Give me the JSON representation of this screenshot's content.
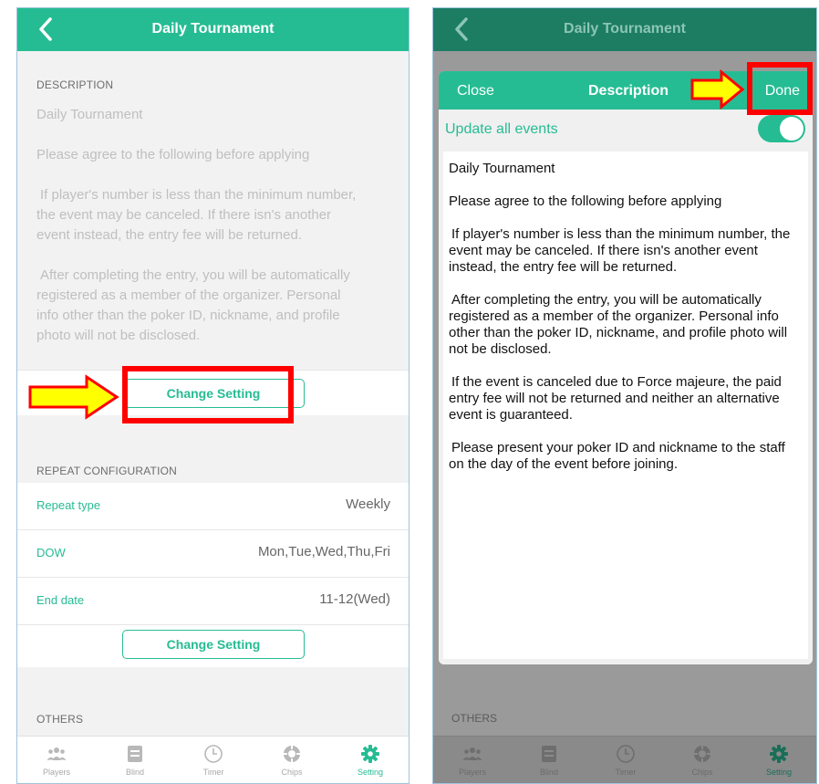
{
  "left": {
    "title": "Daily Tournament",
    "description_header": "DESCRIPTION",
    "description": [
      "Daily Tournament",
      "Please agree to the following before applying",
      "If player's number is less than the minimum number, the event may be canceled. If there isn's another event instead, the entry fee will be returned.",
      "After completing the entry, you will be automatically registered as a member of the organizer. Personal info other than the poker ID, nickname, and profile photo will not be disclosed."
    ],
    "change_setting_1": "Change Setting",
    "repeat_header": "REPEAT CONFIGURATION",
    "rows": [
      {
        "label": "Repeat type",
        "value": "Weekly"
      },
      {
        "label": "DOW",
        "value": "Mon,Tue,Wed,Thu,Fri"
      },
      {
        "label": "End date",
        "value": "11-12(Wed)"
      }
    ],
    "change_setting_2": "Change Setting",
    "others_header": "OTHERS"
  },
  "right": {
    "title": "Daily Tournament",
    "modal": {
      "close": "Close",
      "title": "Description",
      "done": "Done",
      "update_all": "Update all events",
      "toggle_on": true,
      "text": [
        "Daily Tournament",
        "Please agree to the following before applying",
        " If player's number is less than the minimum number, the event may be canceled. If there isn's another event instead, the entry fee will be returned.",
        " After completing the entry, you will be automatically registered as a member of the organizer. Personal info other than the poker ID, nickname, and profile photo will not be disclosed.",
        " If the event is canceled due to Force majeure, the paid entry fee will not be returned and neither an alternative event is guaranteed.",
        " Please present your poker ID and nickname to the staff on the day of the event before joining."
      ]
    },
    "others_header": "OTHERS"
  },
  "tabs": [
    {
      "label": "Players",
      "icon": "players-icon"
    },
    {
      "label": "Blind",
      "icon": "blind-icon"
    },
    {
      "label": "Timer",
      "icon": "timer-icon"
    },
    {
      "label": "Chips",
      "icon": "chips-icon"
    },
    {
      "label": "Setting",
      "icon": "gear-icon"
    }
  ],
  "colors": {
    "accent": "#26bc93",
    "annotation_red": "#ff0000",
    "annotation_arrow": "#ffff00"
  }
}
